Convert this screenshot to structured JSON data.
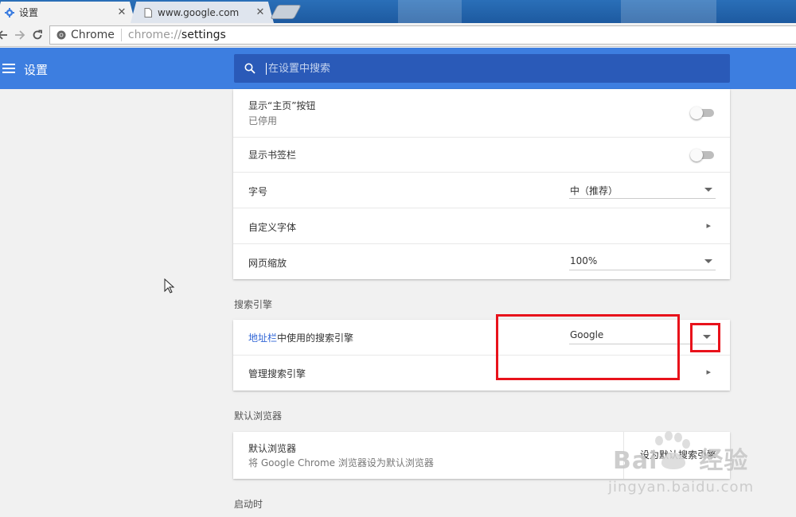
{
  "tabs": [
    {
      "label": "设置",
      "icon": "gear-icon",
      "active": true
    },
    {
      "label": "www.google.com",
      "icon": "page-icon",
      "active": false
    }
  ],
  "toolbar": {
    "site_chip": "Chrome",
    "url_scheme": "chrome://",
    "url_host": "settings"
  },
  "header": {
    "title": "设置",
    "search_placeholder": "在设置中搜索"
  },
  "appearance": {
    "show_home_button": {
      "label": "显示“主页”按钮",
      "sub": "已停用",
      "enabled": false
    },
    "show_bookmarks_bar": {
      "label": "显示书签栏",
      "enabled": false
    },
    "font_size": {
      "label": "字号",
      "value": "中（推荐）"
    },
    "custom_fonts": {
      "label": "自定义字体"
    },
    "page_zoom": {
      "label": "网页缩放",
      "value": "100%"
    }
  },
  "search_engine": {
    "section_title": "搜索引擎",
    "used_engine_link": "地址栏",
    "used_engine_label": "中使用的搜索引擎",
    "used_engine_value": "Google",
    "manage_label": "管理搜索引擎"
  },
  "default_browser": {
    "section_title": "默认浏览器",
    "label": "默认浏览器",
    "sub": "将 Google Chrome 浏览器设为默认浏览器",
    "button": "设为默认搜索引擎"
  },
  "on_startup": {
    "section_title": "启动时"
  },
  "watermark": {
    "brand": "Bai",
    "brand2": "经验",
    "url": "jingyan.baidu.com"
  },
  "colors": {
    "header_blue": "#3d7ee0",
    "search_blue": "#2a5ab8",
    "annotation_red": "#e8121b",
    "link_blue": "#3367d6"
  }
}
